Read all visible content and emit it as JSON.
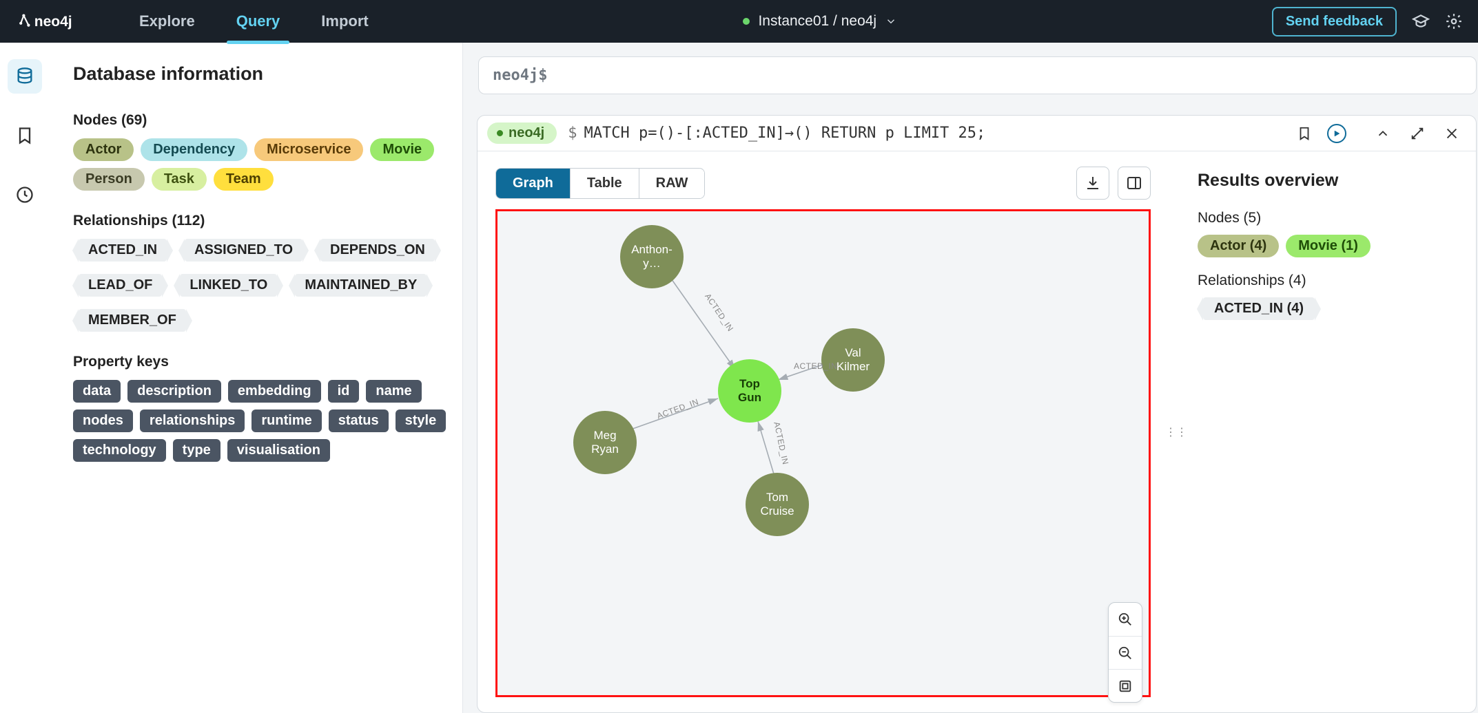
{
  "brand": "neo4j",
  "nav": {
    "explore": "Explore",
    "query": "Query",
    "import": "Import"
  },
  "instance": {
    "name": "Instance01 / neo4j"
  },
  "feedback_label": "Send feedback",
  "cmd_prompt": {
    "db": "neo4j",
    "suffix": "$"
  },
  "query": {
    "db_pill": "neo4j",
    "text": "MATCH p=()-[:ACTED_IN]→() RETURN p LIMIT 25;"
  },
  "views": {
    "graph": "Graph",
    "table": "Table",
    "raw": "RAW"
  },
  "sidebar": {
    "title": "Database information",
    "nodes_header": "Nodes (69)",
    "rel_header": "Relationships (112)",
    "prop_header": "Property keys",
    "node_labels": [
      {
        "text": "Actor",
        "bg": "#b8c288",
        "fg": "#2d340f"
      },
      {
        "text": "Dependency",
        "bg": "#aee3e9",
        "fg": "#144b52"
      },
      {
        "text": "Microservice",
        "bg": "#f7c97b",
        "fg": "#5a3c08"
      },
      {
        "text": "Movie",
        "bg": "#9be96b",
        "fg": "#1e4d07"
      },
      {
        "text": "Person",
        "bg": "#c7c8ae",
        "fg": "#3a3b24"
      },
      {
        "text": "Task",
        "bg": "#d7efa0",
        "fg": "#3e5210"
      },
      {
        "text": "Team",
        "bg": "#ffdf3d",
        "fg": "#4d3f00"
      }
    ],
    "rel_types": [
      "ACTED_IN",
      "ASSIGNED_TO",
      "DEPENDS_ON",
      "LEAD_OF",
      "LINKED_TO",
      "MAINTAINED_BY",
      "MEMBER_OF"
    ],
    "prop_keys": [
      "data",
      "description",
      "embedding",
      "id",
      "name",
      "nodes",
      "relationships",
      "runtime",
      "status",
      "style",
      "technology",
      "type",
      "visualisation"
    ]
  },
  "overview": {
    "title": "Results overview",
    "nodes_label": "Nodes (5)",
    "rel_label": "Relationships (4)",
    "node_chips": [
      {
        "text": "Actor (4)",
        "bg": "#b8c288",
        "fg": "#2d340f"
      },
      {
        "text": "Movie (1)",
        "bg": "#9be96b",
        "fg": "#1e4d07"
      }
    ],
    "rel_chip": "ACTED_IN (4)"
  },
  "graph": {
    "center": {
      "label": "Top\nGun",
      "kind": "movie"
    },
    "actors": [
      {
        "label": "Anthon-\ny…"
      },
      {
        "label": "Val\nKilmer"
      },
      {
        "label": "Tom\nCruise"
      },
      {
        "label": "Meg\nRyan"
      }
    ],
    "edge_label": "ACTED_IN"
  }
}
